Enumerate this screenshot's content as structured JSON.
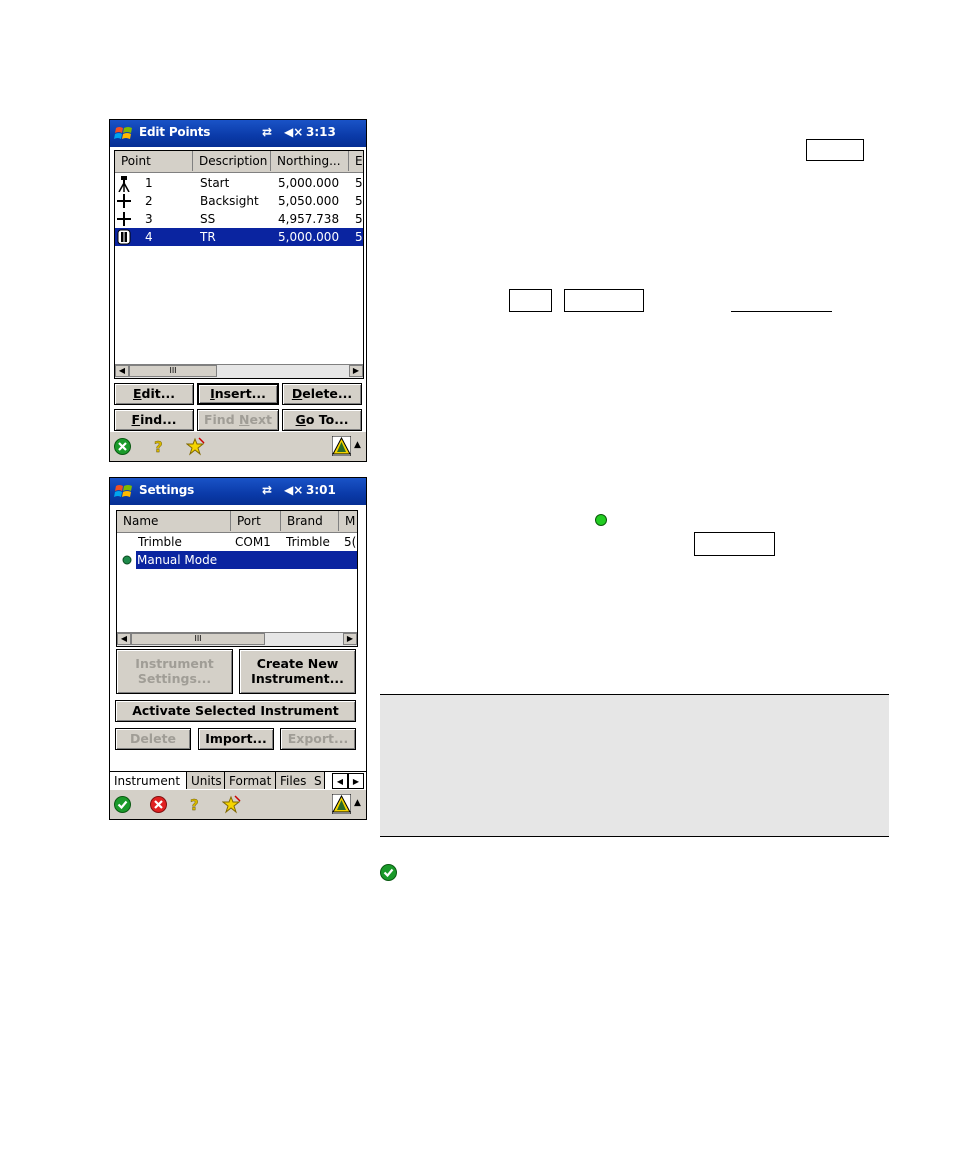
{
  "screen1": {
    "title": "Edit Points",
    "time": "3:13",
    "columns": [
      "Point",
      "Description",
      "Northing...",
      "E"
    ],
    "rows": [
      {
        "icon": "tripod-icon",
        "point": "1",
        "description": "Start",
        "northing": "5,000.000",
        "east": "5"
      },
      {
        "icon": "crosshair-icon",
        "point": "2",
        "description": "Backsight",
        "northing": "5,050.000",
        "east": "5"
      },
      {
        "icon": "crosshair-icon",
        "point": "3",
        "description": "SS",
        "northing": "4,957.738",
        "east": "5"
      },
      {
        "icon": "prism-icon",
        "point": "4",
        "description": "TR",
        "northing": "5,000.000",
        "east": "5"
      }
    ],
    "selected_row": 4,
    "scroll_thumb": "III",
    "buttons": {
      "edit": "Edit...",
      "insert": "Insert...",
      "delete": "Delete...",
      "find": "Find...",
      "find_next": "Find Next",
      "goto": "Go To..."
    }
  },
  "screen2": {
    "title": "Settings",
    "time": "3:01",
    "columns": [
      "Name",
      "Port",
      "Brand",
      "M"
    ],
    "rows": [
      {
        "active": false,
        "name": "Trimble",
        "port": "COM1",
        "brand": "Trimble",
        "model": "5("
      },
      {
        "active": true,
        "name": "Manual Mode",
        "port": "",
        "brand": "",
        "model": ""
      }
    ],
    "selected_row": 2,
    "scroll_thumb": "III",
    "buttons": {
      "instrument_settings_1": "Instrument",
      "instrument_settings_2": "Settings...",
      "create_new_1": "Create New",
      "create_new_2": "Instrument...",
      "activate": "Activate Selected Instrument",
      "delete": "Delete",
      "import": "Import...",
      "export": "Export..."
    },
    "tabs": [
      "Instrument",
      "Units",
      "Format",
      "Files",
      "S"
    ],
    "active_tab": "Instrument"
  },
  "colors": {
    "titlebar": "#0a3aa8",
    "selection": "#0a24a0",
    "button_face": "#d4d0c8",
    "note_background": "#e6e6e6",
    "active_dot": "#22cc22"
  }
}
